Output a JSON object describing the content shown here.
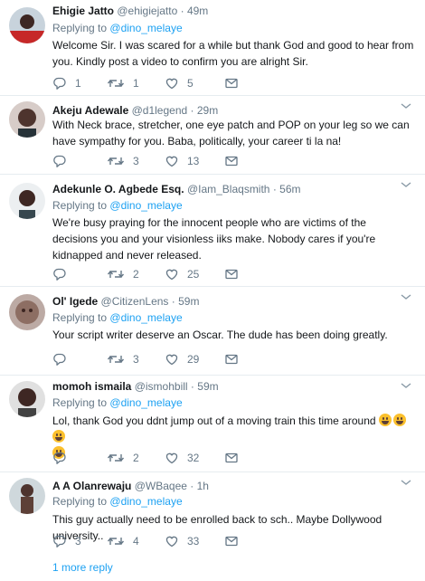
{
  "tweets": [
    {
      "name": "Ehigie Jatto",
      "handle": "@ehigiejatto",
      "time": "49m",
      "replying_prefix": "Replying to",
      "replying_to": "@dino_melaye",
      "text": "Welcome Sir. I was scared for a while but thank God and good to hear from you. Kindly post a video to confirm you are alright Sir.",
      "replies": "1",
      "retweets": "1",
      "likes": "5"
    },
    {
      "name": "Akeju Adewale",
      "handle": "@d1legend",
      "time": "29m",
      "text": "With Neck brace, stretcher, one eye patch and POP on your leg so we can have sympathy for you. Baba, politically, your career ti la na!",
      "replies": "",
      "retweets": "3",
      "likes": "13"
    },
    {
      "name": "Adekunle O. Agbede Esq.",
      "handle": "@Iam_Blaqsmith",
      "time": "56m",
      "replying_prefix": "Replying to",
      "replying_to": "@dino_melaye",
      "text": "We're busy praying for the innocent people who are victims of the decisions you and your visionless iiks make. Nobody cares if you're kidnapped and never released.",
      "replies": "",
      "retweets": "2",
      "likes": "25"
    },
    {
      "name": "Ol' Igede",
      "handle": "@CitizenLens",
      "time": "59m",
      "replying_prefix": "Replying to",
      "replying_to": "@dino_melaye",
      "text": "Your script writer deserve an Oscar. The dude has been doing greatly.",
      "replies": "",
      "retweets": "3",
      "likes": "29"
    },
    {
      "name": "momoh ismaila",
      "handle": "@ismohbill",
      "time": "59m",
      "replying_prefix": "Replying to",
      "replying_to": "@dino_melaye",
      "text": "Lol, thank God you ddnt jump out of a moving train this time around",
      "replies": "",
      "retweets": "2",
      "likes": "32"
    },
    {
      "name": "A A Olanrewaju",
      "handle": "@WBaqee",
      "time": "1h",
      "replying_prefix": "Replying to",
      "replying_to": "@dino_melaye",
      "text": "This guy actually need to be enrolled back to sch.. Maybe Dollywood university..",
      "replies": "3",
      "retweets": "4",
      "likes": "33"
    }
  ],
  "separator": "·",
  "more_replies": "1 more reply",
  "icons": [
    "reply-icon",
    "retweet-icon",
    "like-icon",
    "message-icon",
    "chevron-down-icon"
  ],
  "colors": {
    "name": "#14171a",
    "meta": "#657786",
    "mention": "#1da1f2",
    "divider": "#e6ecf0"
  }
}
